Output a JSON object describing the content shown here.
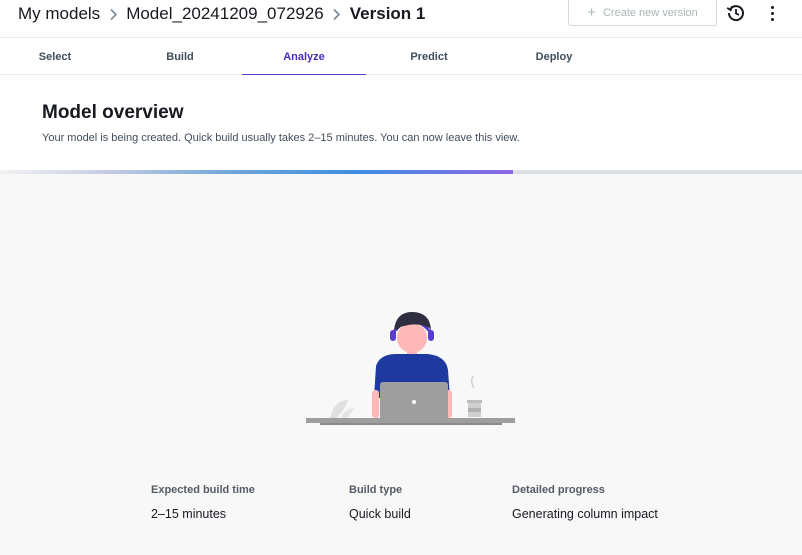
{
  "breadcrumb": {
    "items": [
      "My models",
      "Model_20241209_072926",
      "Version 1"
    ]
  },
  "header": {
    "create_version_label": "Create new version",
    "history_icon": "history-icon",
    "more_icon": "more-vertical-icon"
  },
  "tabs": [
    {
      "label": "Select",
      "active": false
    },
    {
      "label": "Build",
      "active": false
    },
    {
      "label": "Analyze",
      "active": true
    },
    {
      "label": "Predict",
      "active": false
    },
    {
      "label": "Deploy",
      "active": false
    }
  ],
  "overview": {
    "title": "Model overview",
    "message": "Your model is being created. Quick build usually takes 2–15 minutes. You can now leave this view."
  },
  "progress": {
    "fraction": 0.64
  },
  "stats": [
    {
      "label": "Expected build time",
      "value": "2–15 minutes"
    },
    {
      "label": "Build type",
      "value": "Quick build"
    },
    {
      "label": "Detailed progress",
      "value": "Generating column impact"
    }
  ],
  "colors": {
    "accent": "#5b3bd0",
    "progress_start": "#6fa6d8",
    "progress_end": "#8f69e2",
    "background": "#f8f8f9"
  }
}
